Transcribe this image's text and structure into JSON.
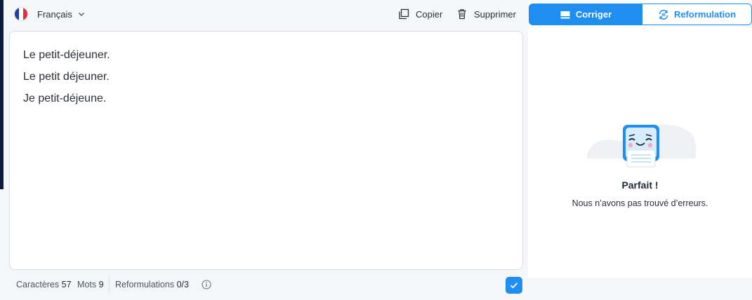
{
  "language": {
    "label": "Français",
    "flag": "french-flag"
  },
  "toolbar": {
    "copy_label": "Copier",
    "delete_label": "Supprimer"
  },
  "editor": {
    "lines": [
      "Le petit-déjeuner.",
      "Le petit déjeuner.",
      "Je petit-déjeune."
    ]
  },
  "footer": {
    "chars_label": "Caractères",
    "chars_value": "57",
    "words_label": "Mots",
    "words_value": "9",
    "reform_label": "Reformulations",
    "reform_value": "0/3"
  },
  "tabs": {
    "correct_label": "Corriger",
    "reform_label": "Reformulation"
  },
  "result": {
    "title": "Parfait !",
    "message": "Nous n’avons pas trouvé d’erreurs."
  },
  "colors": {
    "accent": "#1f8ef1",
    "panel_bg": "#f4f6f8",
    "sidebar": "#0d1b3e"
  }
}
